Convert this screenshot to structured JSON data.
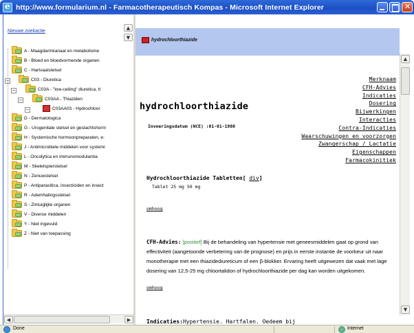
{
  "window": {
    "title": "http://www.formularium.nl - Farmacotherapeutisch Kompas - Microsoft Internet Explorer"
  },
  "left": {
    "new_search": "Nieuwe zoekactie",
    "tree": [
      {
        "label": "A - Maagdarmkanaal en metabolisme"
      },
      {
        "label": "B - Bloed en bloedvormende organen"
      },
      {
        "label": "C - Hartvaatstelsel"
      },
      {
        "label": "C03 - Diuretica"
      },
      {
        "label": "C03A - \"low-ceiling\" diuretica, tl"
      },
      {
        "label": "C03AA - Thiaziden"
      },
      {
        "label": "C03AA03 - Hydrochloor"
      },
      {
        "label": "D - Dermatologica"
      },
      {
        "label": "G - Urogenitale stelsel en geslachtshorm"
      },
      {
        "label": "H - Systemische hormoonpreparaten, e:"
      },
      {
        "label": "J - Antimicrobiele middelen voor systemi"
      },
      {
        "label": "L - Oncolytica en immunomodulantia"
      },
      {
        "label": "M - Skeletspierstelsel"
      },
      {
        "label": "N - Zenuwstelsel"
      },
      {
        "label": "P - Antiparasitica, insecticiden en insect"
      },
      {
        "label": "R - Ademhalingsstelsel"
      },
      {
        "label": "S - Zintuiglijke organen"
      },
      {
        "label": "V - Diverse middelen"
      },
      {
        "label": "Y - Niet ingevuld"
      },
      {
        "label": "Z - Niet van toepassing"
      }
    ]
  },
  "main": {
    "banner_title": "hydrochloorthiazide",
    "nav_links": [
      "Merknaam",
      "CFH-Advies",
      "Indicaties",
      "Dosering",
      "Bijwerkingen",
      "Interacties",
      "Contra-Indicaties",
      "Waarschuwingen en voorzorgen",
      "Zwangerschap / Lactatie",
      "Eigenschappen",
      "Farmacokinitiek"
    ],
    "drug_title": "hydrochloorthiazide",
    "invoer": "Invoeringsdatum (NCE) :01-01-1980",
    "product_heading": "Hydrochloorthiazide Tabletten",
    "product_div_pre": "[ ",
    "product_div": "div",
    "product_div_post": "]",
    "product_sub": "Tablet 25 mg 50 mg",
    "omhoog": "omhoog",
    "cfh_label": "CFH-Advies:",
    "cfh_positief": "[positief]",
    "cfh_text": " Bij de behandeling van hypertensie met geneesmiddelen gaat op grond van effectiviteit (aangetoonde verbetering van de prognose) en prijs in eerste instantie de voorkeur uit naar monotherapie met een thiazidediureticum of een β-blokker. Ervaring heeft uitgewezen dat vaak met lage dosering van 12,5-25 mg chloortalidon of hydrochloorthiazide per dag kan worden uitgekomen.",
    "indic_label": "Indicaties:",
    "indic_text": "Hypertensie. Hartfalen. Oedeem bij"
  },
  "status": {
    "text": "Done",
    "zone": "Internet"
  }
}
